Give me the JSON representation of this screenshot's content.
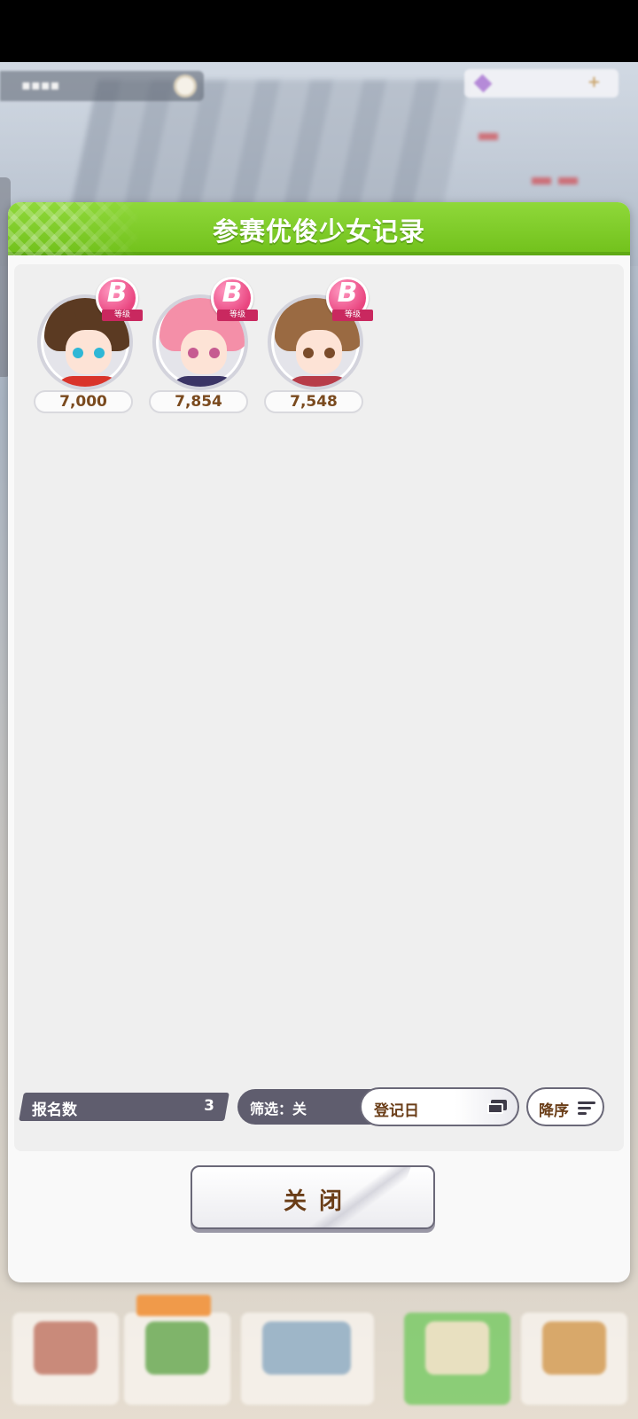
{
  "modal": {
    "title": "参赛优俊少女记录",
    "entries": [
      {
        "grade": "B",
        "grade_label": "等级",
        "score": "7,000",
        "hair_color": "#5b3a22",
        "outfit_color": "#d9342b",
        "eye_color": "#2fb7d6"
      },
      {
        "grade": "B",
        "grade_label": "等级",
        "score": "7,854",
        "hair_color": "#f48fa8",
        "outfit_color": "#3b3566",
        "eye_color": "#c65b91"
      },
      {
        "grade": "B",
        "grade_label": "等级",
        "score": "7,548",
        "hair_color": "#9a6a42",
        "outfit_color": "#b73c49",
        "eye_color": "#7a4b2a"
      }
    ],
    "count_label": "报名数",
    "count_value": "3",
    "filter_label": "筛选：关",
    "sort_key": "登记日",
    "sort_order": "降序",
    "close_label": "关闭"
  },
  "colors": {
    "header_green": "#7ccb2a",
    "grade_pink": "#e9457f",
    "score_brown": "#7a4a1e"
  }
}
